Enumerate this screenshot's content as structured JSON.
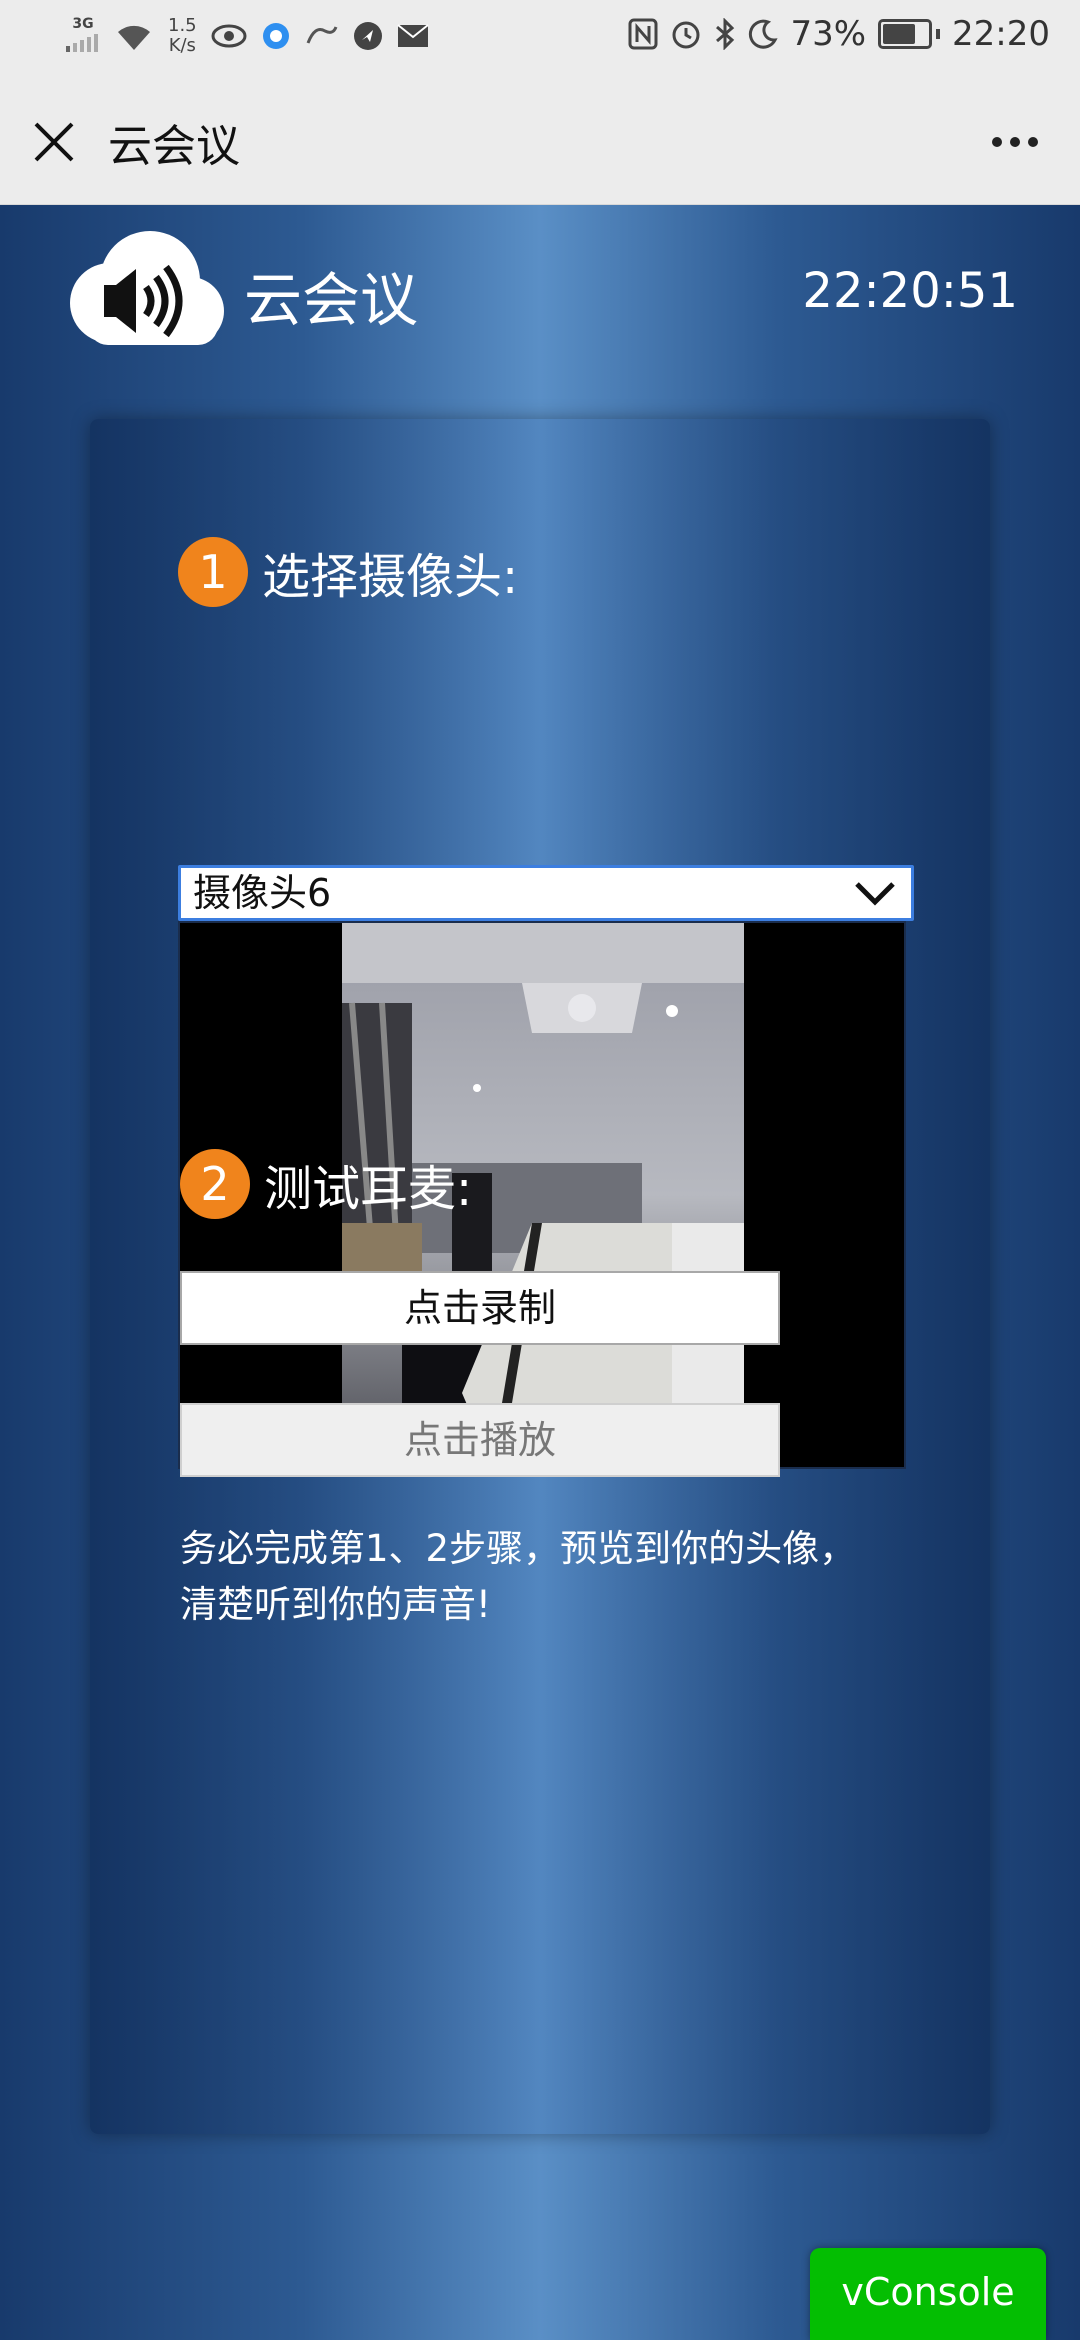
{
  "status_bar": {
    "net_type": "3G",
    "net_speed_value": "1.5",
    "net_speed_unit": "K/s",
    "battery_percent": "73%",
    "battery_level": 0.73,
    "time": "22:20"
  },
  "wechat_bar": {
    "title": "云会议"
  },
  "header": {
    "app_name": "云会议",
    "clock": "22:20:51"
  },
  "step1": {
    "number": "1",
    "label": "选择摄像头:",
    "camera_selected": "摄像头6"
  },
  "step2": {
    "number": "2",
    "label": "测试耳麦:",
    "record_button": "点击录制",
    "play_button": "点击播放"
  },
  "notice": {
    "line1": "务必完成第1、2步骤，预览到你的头像，",
    "line2": "清楚听到你的声音!"
  },
  "vconsole_label": "vConsole",
  "colors": {
    "step_badge": "#f0841c",
    "vconsole": "#04be02",
    "select_border": "#3c7ee0"
  },
  "icons": {
    "close": "close-icon",
    "more": "more-icon",
    "logo": "cloud-speaker-icon",
    "dropdown": "chevron-down-icon"
  }
}
